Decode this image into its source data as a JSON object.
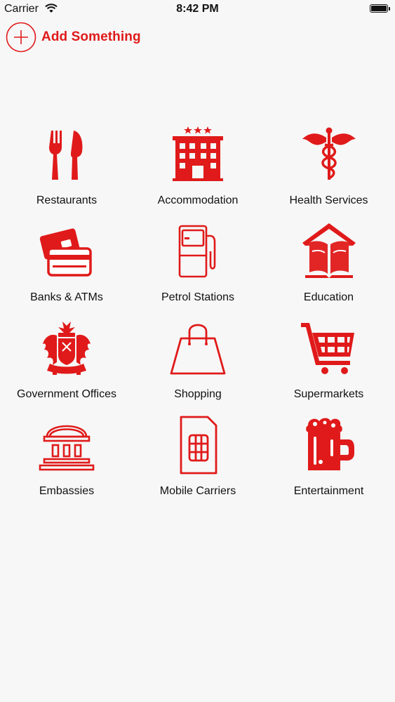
{
  "status_bar": {
    "carrier": "Carrier",
    "time": "8:42 PM",
    "wifi_icon": "wifi-icon",
    "battery_icon": "battery-icon",
    "battery_level": 1.0
  },
  "header": {
    "add_label": "Add Something",
    "add_icon": "plus-circle-icon"
  },
  "accent_color": "#e01a1a",
  "categories": [
    {
      "label": "Restaurants",
      "icon": "fork-knife-icon"
    },
    {
      "label": "Accommodation",
      "icon": "hotel-icon"
    },
    {
      "label": "Health Services",
      "icon": "caduceus-icon"
    },
    {
      "label": "Banks & ATMs",
      "icon": "credit-card-icon"
    },
    {
      "label": "Petrol Stations",
      "icon": "fuel-pump-icon"
    },
    {
      "label": "Education",
      "icon": "book-house-icon"
    },
    {
      "label": "Government Offices",
      "icon": "coat-of-arms-icon"
    },
    {
      "label": "Shopping",
      "icon": "shopping-bag-icon"
    },
    {
      "label": "Supermarkets",
      "icon": "shopping-cart-icon"
    },
    {
      "label": "Embassies",
      "icon": "embassy-building-icon"
    },
    {
      "label": "Mobile Carriers",
      "icon": "sim-card-icon"
    },
    {
      "label": "Entertainment",
      "icon": "beer-mug-icon"
    }
  ]
}
